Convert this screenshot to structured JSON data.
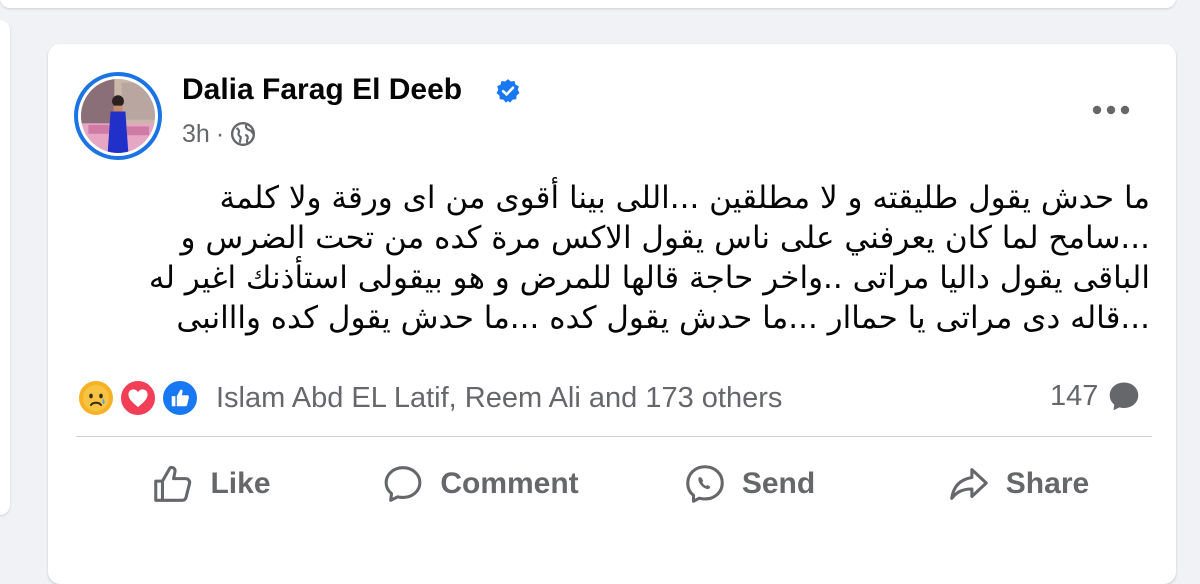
{
  "post": {
    "author": "Dalia Farag El Deeb",
    "time": "3h",
    "separator": "·",
    "privacy_icon": "globe-icon",
    "verified_icon": "verified-badge-icon",
    "text_lines": [
      "ما حدش يقول طليقته و لا مطلقين ...اللى بينا أقوى من اى ورقة ولا كلمة",
      "...سامح لما كان يعرفني على ناس يقول الاكس مرة كده من تحت الضرس و",
      "الباقى يقول داليا مراتى ..واخر حاجة قالها للمرض و هو بيقولى استأذنك اغير له",
      "...قاله دى مراتى يا حماار  ...ما حدش يقول كده ...ما حدش يقول كده وااانبى"
    ]
  },
  "reactions": {
    "icons": [
      "sad-reaction-icon",
      "love-reaction-icon",
      "like-reaction-icon"
    ],
    "summary": "Islam Abd EL Latif, Reem Ali and 173 others",
    "comments_count": "147"
  },
  "actions": {
    "like": "Like",
    "comment": "Comment",
    "send": "Send",
    "share": "Share"
  },
  "colors": {
    "brand_blue": "#1877f2",
    "secondary_text": "#65676b",
    "love_red": "#f33e58",
    "sad_yellow": "#f7b125"
  }
}
